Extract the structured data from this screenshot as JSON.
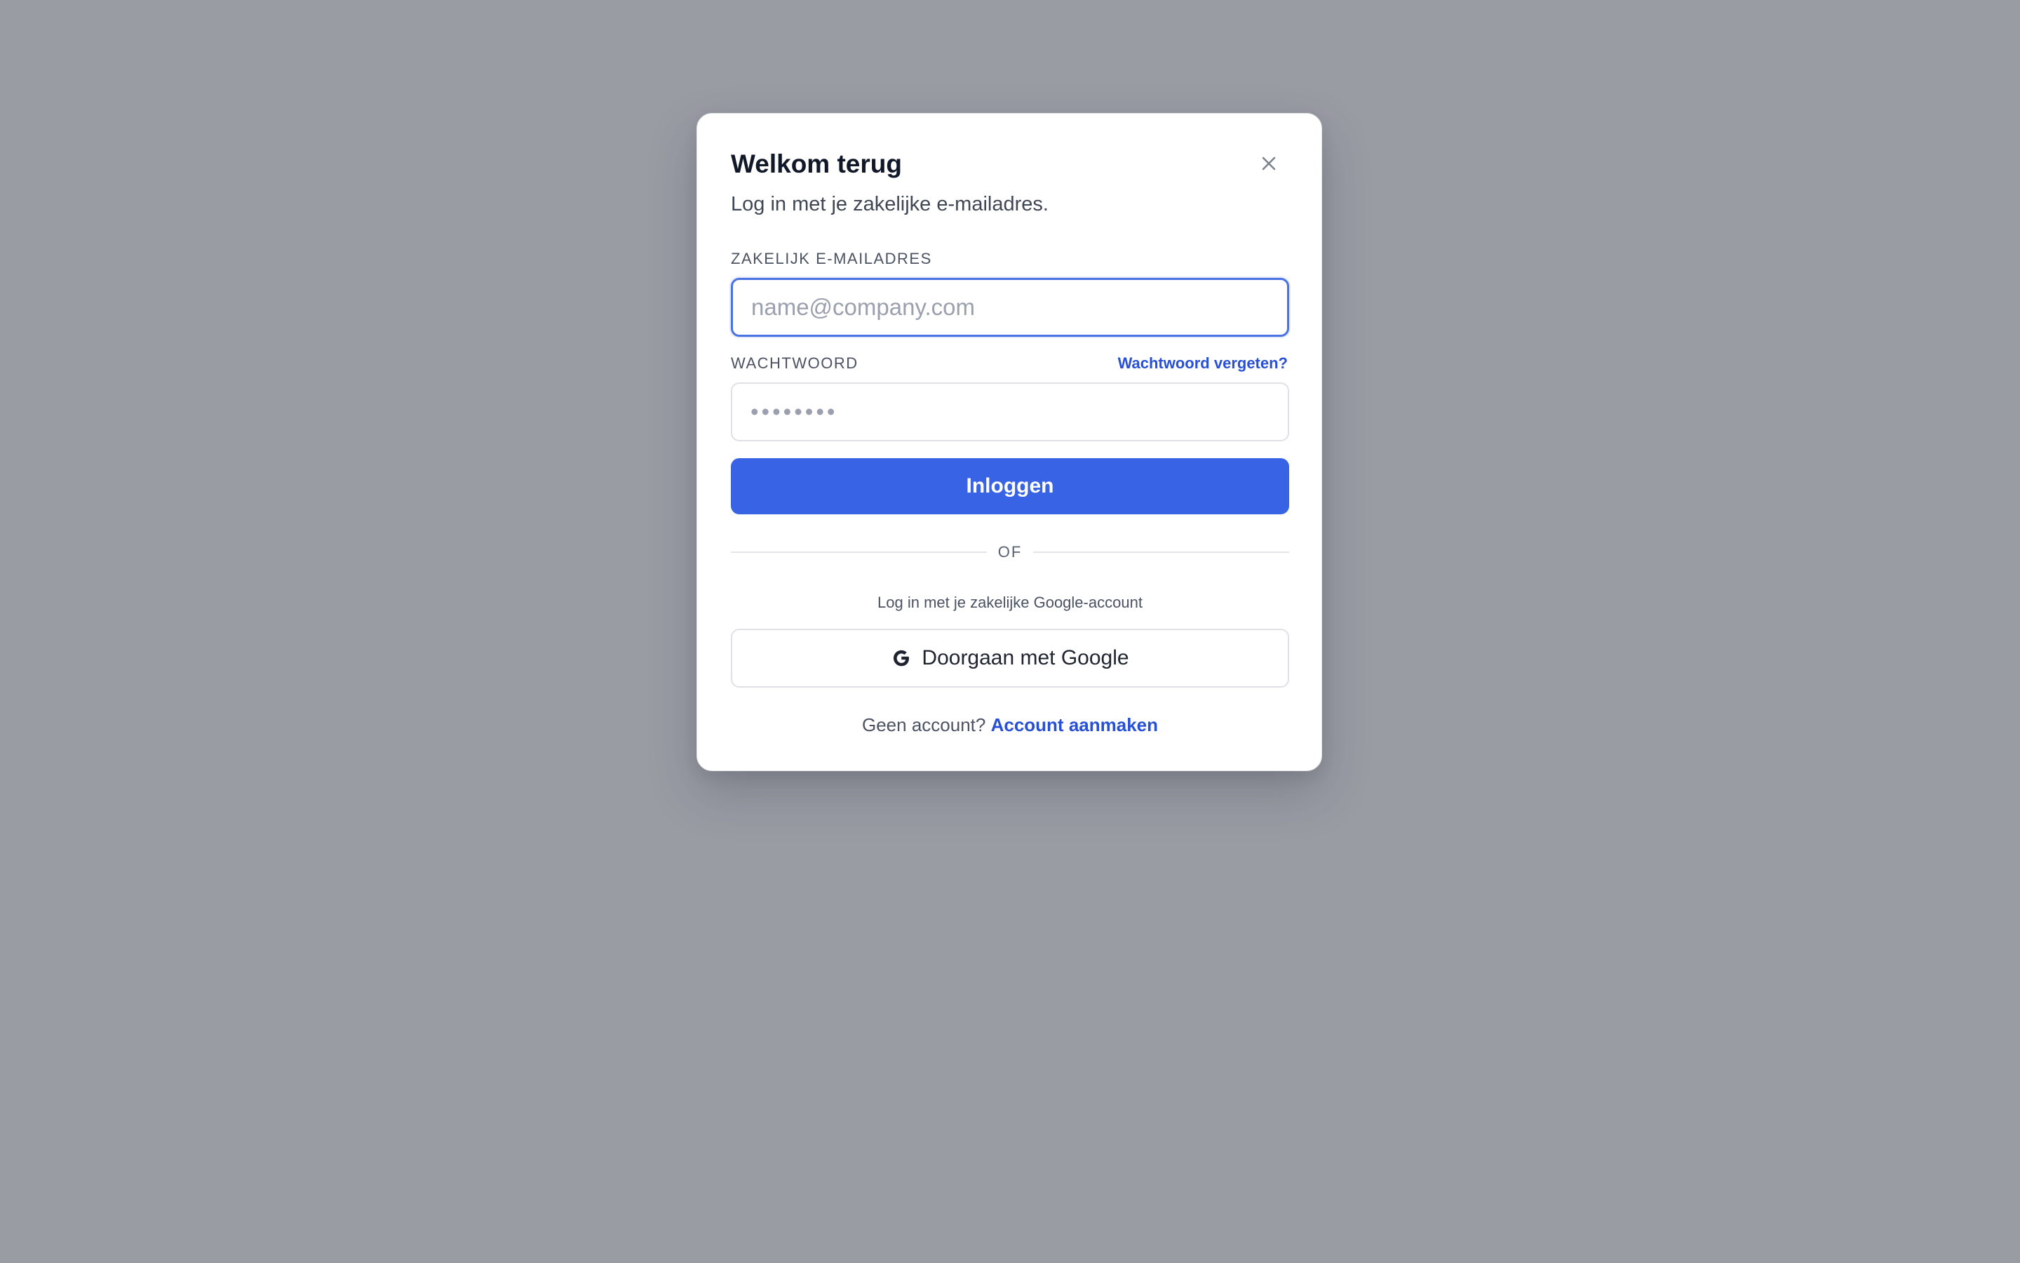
{
  "modal": {
    "title": "Welkom terug",
    "subtitle": "Log in met je zakelijke e-mailadres."
  },
  "icons": {
    "close": "close-icon",
    "google": "google-icon"
  },
  "email": {
    "label": "ZAKELIJK E-MAILADRES",
    "placeholder": "name@company.com",
    "value": ""
  },
  "password": {
    "label": "WACHTWOORD",
    "placeholder": "••••••••",
    "value": "",
    "forgot_link": "Wachtwoord vergeten?"
  },
  "login_button": "Inloggen",
  "divider": "OF",
  "google": {
    "hint": "Log in met je zakelijke Google-account",
    "button_label": "Doorgaan met Google"
  },
  "footer": {
    "text": "Geen account?",
    "link": "Account aanmaken"
  },
  "colors": {
    "backdrop": "#9a9ca4",
    "primary": "#3763e4",
    "link": "#2750d6",
    "focus_border": "#4a72e0"
  }
}
